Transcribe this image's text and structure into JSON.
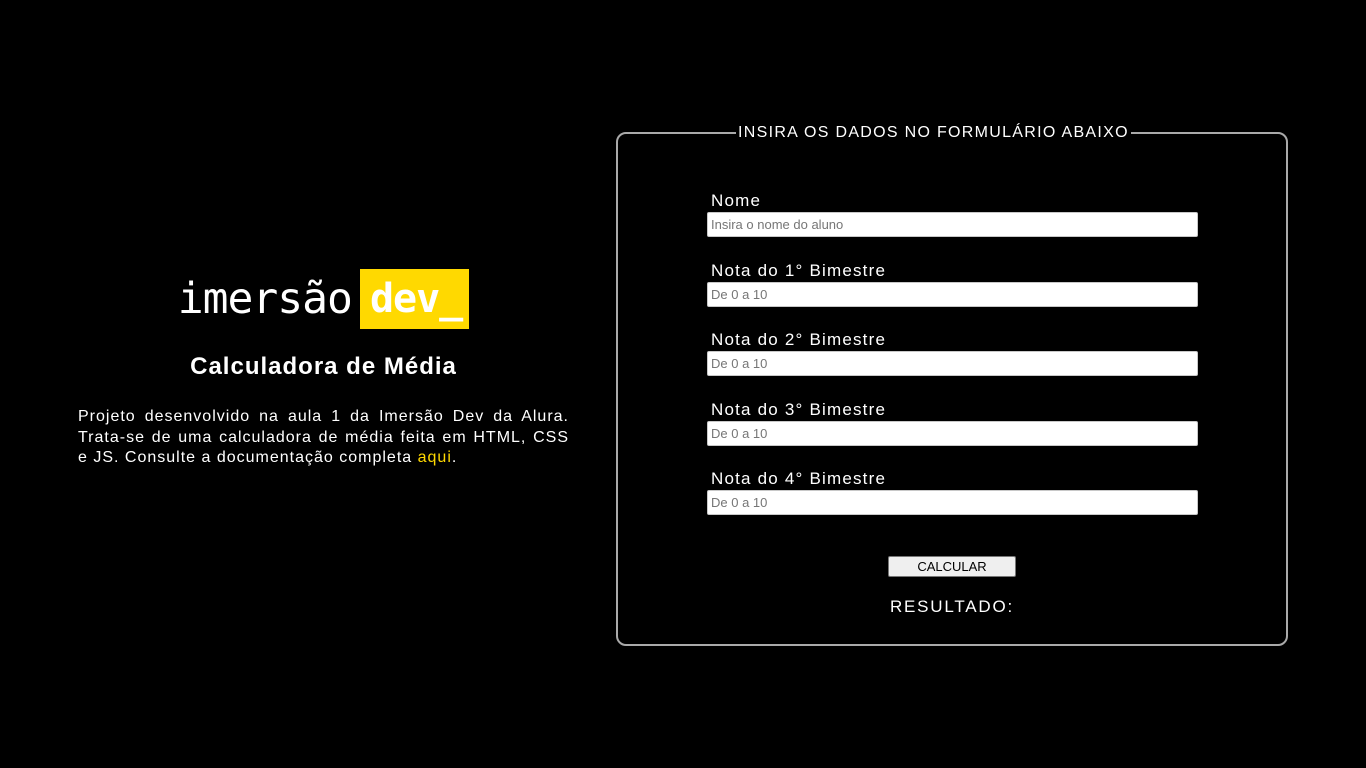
{
  "intro": {
    "logo_word": "imersão",
    "logo_highlight": "dev_",
    "title": "Calculadora de Média",
    "description_prefix": "Projeto desenvolvido na aula 1 da Imersão Dev da Alura. Trata-se de uma calculadora de média feita em HTML, CSS e JS. Consulte a documentação completa ",
    "link_text": "aqui",
    "description_suffix": "."
  },
  "form": {
    "legend": "INSIRA OS DADOS NO FORMULÁRIO ABAIXO",
    "fields": [
      {
        "label": "Nome",
        "value": "",
        "placeholder": "Insira o nome do aluno"
      },
      {
        "label": "Nota do 1° Bimestre",
        "value": "",
        "placeholder": "De 0 a 10"
      },
      {
        "label": "Nota do 2° Bimestre",
        "value": "",
        "placeholder": "De 0 a 10"
      },
      {
        "label": "Nota do 3° Bimestre",
        "value": "",
        "placeholder": "De 0 a 10"
      },
      {
        "label": "Nota do 4° Bimestre",
        "value": "",
        "placeholder": "De 0 a 10"
      }
    ],
    "button_label": "CALCULAR",
    "result_label": "RESULTADO:"
  },
  "colors": {
    "background": "#000000",
    "accent": "#ffd900",
    "text": "#ffffff",
    "border": "#a9a9a9"
  }
}
